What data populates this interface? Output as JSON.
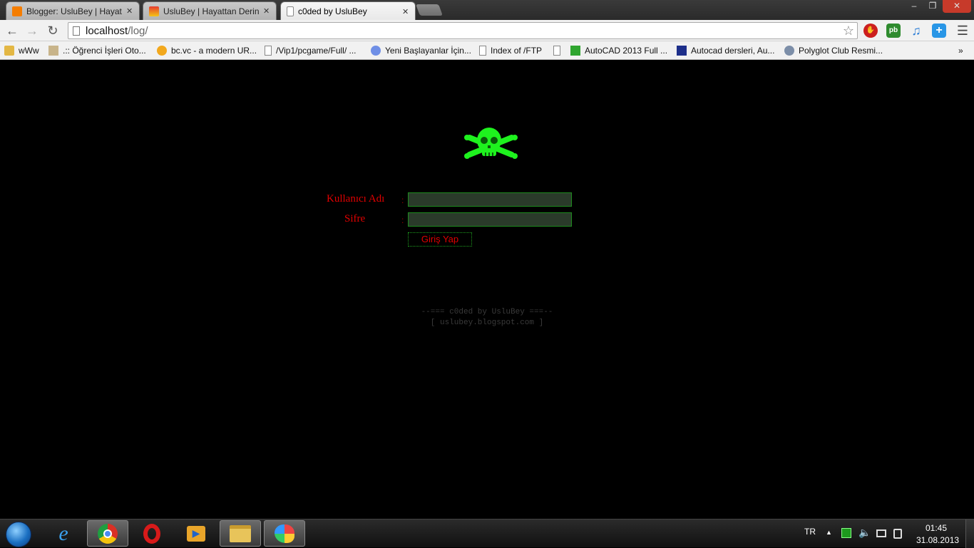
{
  "browser": {
    "tabs": [
      {
        "title": "Blogger: UsluBey | Hayatta",
        "active": false
      },
      {
        "title": "UsluBey | Hayattan Derin B",
        "active": false
      },
      {
        "title": "c0ded by UsluBey",
        "active": true
      }
    ],
    "tab_close": "✕",
    "window_controls": {
      "minimize": "–",
      "restore": "❐",
      "close": "✕"
    },
    "url": {
      "host": "localhost",
      "path": "/log/"
    },
    "star": "☆",
    "extensions": [
      {
        "name": "adblock-icon",
        "color": "#cc1f1f"
      },
      {
        "name": "pushbullet-icon",
        "color": "#2e8b2e"
      },
      {
        "name": "music-icon",
        "color": "#2f7fd6"
      },
      {
        "name": "plus-icon",
        "color": "#2996e6"
      }
    ],
    "menu": "☰",
    "bookmarks": [
      {
        "label": "wWw"
      },
      {
        "label": ".:: Öğrenci İşleri Oto..."
      },
      {
        "label": "bc.vc - a modern UR..."
      },
      {
        "label": "/Vip1/pcgame/Full/ ..."
      },
      {
        "label": "Yeni Başlayanlar İçin..."
      },
      {
        "label": "Index of /FTP"
      },
      {
        "label": "AutoCAD 2013 Full ..."
      },
      {
        "label": "Autocad dersleri, Au..."
      },
      {
        "label": "Polyglot Club Resmi..."
      }
    ],
    "bookmarks_overflow": "»"
  },
  "page": {
    "form": {
      "username_label": "Kullanıcı Adı",
      "password_label": "Sifre",
      "colon": ":",
      "username_value": "",
      "password_value": "",
      "login_button": "Giriş Yap"
    },
    "footer": {
      "line1": "--=== c0ded by UsluBey ===--",
      "line2": "[ uslubey.blogspot.com ]"
    },
    "colors": {
      "label": "#e00000",
      "accent_green": "#1ea01e",
      "skull": "#1ef21e"
    }
  },
  "taskbar": {
    "language": "TR",
    "tray_arrow": "▲",
    "time": "01:45",
    "date": "31.08.2013"
  }
}
